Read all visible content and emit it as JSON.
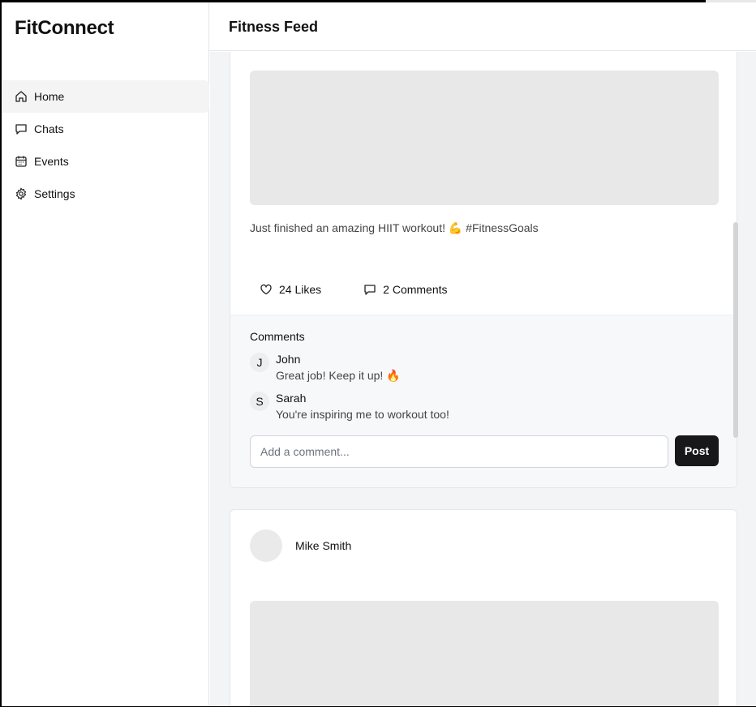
{
  "app": {
    "brand": "FitConnect",
    "page_title": "Fitness Feed"
  },
  "sidebar": {
    "items": [
      {
        "label": "Home",
        "icon": "home-icon",
        "active": true
      },
      {
        "label": "Chats",
        "icon": "chat-icon",
        "active": false
      },
      {
        "label": "Events",
        "icon": "calendar-icon",
        "active": false
      },
      {
        "label": "Settings",
        "icon": "gear-icon",
        "active": false
      }
    ]
  },
  "feed": {
    "post1": {
      "caption": "Just finished an amazing HIIT workout! 💪 #FitnessGoals",
      "likes": "24 Likes",
      "comments_count": "2 Comments",
      "comments_title": "Comments",
      "comments": [
        {
          "initial": "J",
          "name": "John",
          "text": "Great job! Keep it up! 🔥"
        },
        {
          "initial": "S",
          "name": "Sarah",
          "text": "You're inspiring me to workout too!"
        }
      ],
      "comment_placeholder": "Add a comment...",
      "post_label": "Post"
    },
    "post2": {
      "author": "Mike Smith"
    }
  },
  "colors": {
    "accent": "#18181b",
    "active_nav": "#f4f4f5",
    "background": "#f3f4f6",
    "placeholder_media": "#e8e8e8"
  }
}
